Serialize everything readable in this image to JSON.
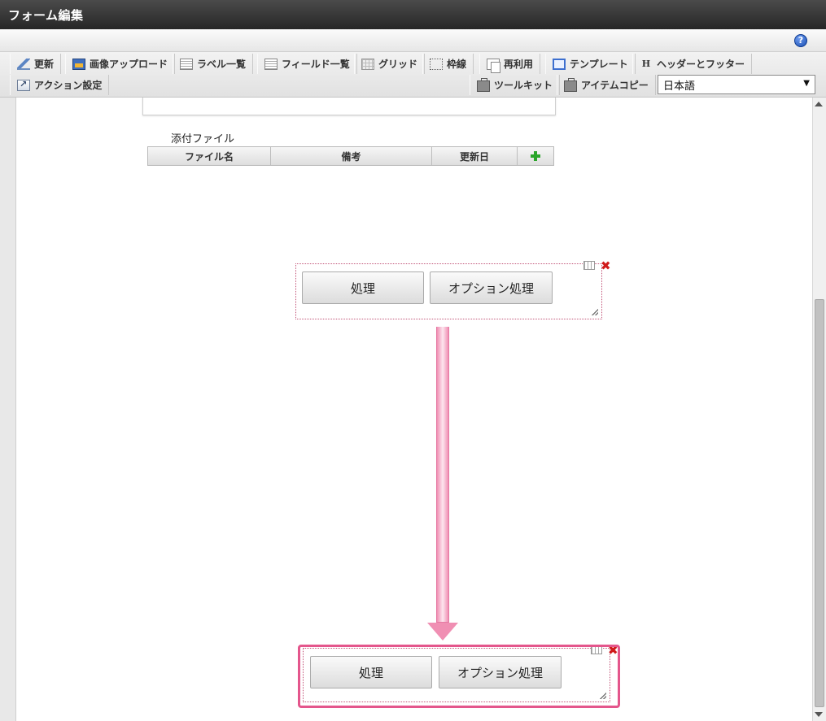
{
  "window": {
    "title": "フォーム編集"
  },
  "help": {
    "icon": "help-icon",
    "glyph": "?"
  },
  "toolbar": {
    "row1": [
      {
        "label": "更新",
        "icon": "update-icon"
      },
      {
        "label": "画像アップロード",
        "icon": "image-upload-icon"
      },
      {
        "label": "ラベル一覧",
        "icon": "label-list-icon"
      },
      {
        "label": "フィールド一覧",
        "icon": "field-list-icon"
      },
      {
        "label": "グリッド",
        "icon": "grid-icon"
      },
      {
        "label": "枠線",
        "icon": "border-icon"
      },
      {
        "label": "再利用",
        "icon": "reuse-icon"
      },
      {
        "label": "テンプレート",
        "icon": "template-icon"
      },
      {
        "label": "ヘッダーとフッター",
        "icon": "header-footer-icon",
        "glyph": "H"
      }
    ],
    "row2_left": [
      {
        "label": "アクション設定",
        "icon": "action-settings-icon"
      }
    ],
    "row2_right": [
      {
        "label": "ツールキット",
        "icon": "toolkit-icon"
      },
      {
        "label": "アイテムコピー",
        "icon": "item-copy-icon"
      }
    ],
    "language": {
      "selected": "日本語",
      "arrow": "▼"
    }
  },
  "attachments": {
    "label": "添付ファイル",
    "columns": [
      "ファイル名",
      "備考",
      "更新日"
    ]
  },
  "button_box_before": {
    "buttons": [
      "処理",
      "オプション処理"
    ]
  },
  "button_box_after": {
    "buttons": [
      "処理",
      "オプション処理"
    ]
  },
  "colors": {
    "highlight": "#e4568c",
    "arrow": "#f08fb3",
    "close": "#d01b1b",
    "add": "#2aa52a"
  }
}
